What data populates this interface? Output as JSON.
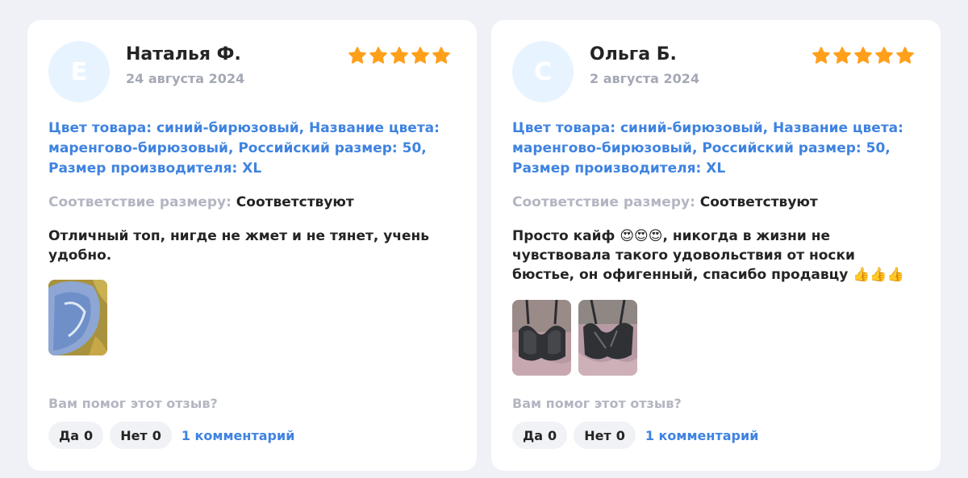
{
  "colors": {
    "background": "#eff1f6",
    "accent": "#3f83e0",
    "star": "#ff9f1a",
    "avatar": "#e7f4ff",
    "muted": "#b3b6c2"
  },
  "reviews": [
    {
      "avatar_letter": "Е",
      "author": "Наталья Ф.",
      "date": "24 августа 2024",
      "rating": 5,
      "specs": "Цвет товара: синий-бирюзовый, Название цвета: маренгово-бирюзовый, Российский размер: 50, Размер производителя: XL",
      "fit_label": "Соответствие размеру:",
      "fit_value": "Соответствуют",
      "text": "Отличный топ, нигде не жмет и не тянет, учень удобно.",
      "photos": [
        "blue-bra-photo"
      ],
      "helpful_question": "Вам помог этот отзыв?",
      "yes_label": "Да",
      "yes_count": "0",
      "no_label": "Нет",
      "no_count": "0",
      "comments_link": "1 комментарий"
    },
    {
      "avatar_letter": "С",
      "author": "Ольга Б.",
      "date": "2 августа 2024",
      "rating": 5,
      "specs": "Цвет товара: синий-бирюзовый, Название цвета: маренгово-бирюзовый, Российский размер: 50, Размер производителя: XL",
      "fit_label": "Соответствие размеру:",
      "fit_value": "Соответствуют",
      "text_before": "Просто кайф ",
      "text_emoji_1": "😍😍😍",
      "text_middle": ", никогда в жизни не чувствовала такого удовольствия от носки бюстье, он офигенный, спасибо продавцу ",
      "text_emoji_2": "👍👍👍",
      "photos": [
        "black-bra-photo-front",
        "black-bra-photo-angle"
      ],
      "helpful_question": "Вам помог этот отзыв?",
      "yes_label": "Да",
      "yes_count": "0",
      "no_label": "Нет",
      "no_count": "0",
      "comments_link": "1 комментарий"
    }
  ]
}
